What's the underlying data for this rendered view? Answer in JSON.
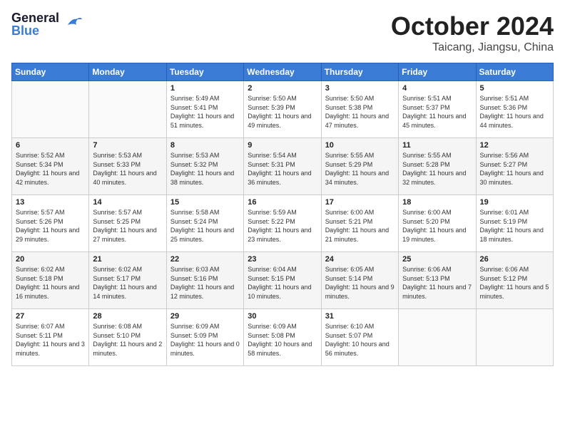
{
  "logo": {
    "general": "General",
    "blue": "Blue"
  },
  "title": "October 2024",
  "subtitle": "Taicang, Jiangsu, China",
  "weekdays": [
    "Sunday",
    "Monday",
    "Tuesday",
    "Wednesday",
    "Thursday",
    "Friday",
    "Saturday"
  ],
  "weeks": [
    [
      {
        "day": "",
        "info": ""
      },
      {
        "day": "",
        "info": ""
      },
      {
        "day": "1",
        "info": "Sunrise: 5:49 AM\nSunset: 5:41 PM\nDaylight: 11 hours and 51 minutes."
      },
      {
        "day": "2",
        "info": "Sunrise: 5:50 AM\nSunset: 5:39 PM\nDaylight: 11 hours and 49 minutes."
      },
      {
        "day": "3",
        "info": "Sunrise: 5:50 AM\nSunset: 5:38 PM\nDaylight: 11 hours and 47 minutes."
      },
      {
        "day": "4",
        "info": "Sunrise: 5:51 AM\nSunset: 5:37 PM\nDaylight: 11 hours and 45 minutes."
      },
      {
        "day": "5",
        "info": "Sunrise: 5:51 AM\nSunset: 5:36 PM\nDaylight: 11 hours and 44 minutes."
      }
    ],
    [
      {
        "day": "6",
        "info": "Sunrise: 5:52 AM\nSunset: 5:34 PM\nDaylight: 11 hours and 42 minutes."
      },
      {
        "day": "7",
        "info": "Sunrise: 5:53 AM\nSunset: 5:33 PM\nDaylight: 11 hours and 40 minutes."
      },
      {
        "day": "8",
        "info": "Sunrise: 5:53 AM\nSunset: 5:32 PM\nDaylight: 11 hours and 38 minutes."
      },
      {
        "day": "9",
        "info": "Sunrise: 5:54 AM\nSunset: 5:31 PM\nDaylight: 11 hours and 36 minutes."
      },
      {
        "day": "10",
        "info": "Sunrise: 5:55 AM\nSunset: 5:29 PM\nDaylight: 11 hours and 34 minutes."
      },
      {
        "day": "11",
        "info": "Sunrise: 5:55 AM\nSunset: 5:28 PM\nDaylight: 11 hours and 32 minutes."
      },
      {
        "day": "12",
        "info": "Sunrise: 5:56 AM\nSunset: 5:27 PM\nDaylight: 11 hours and 30 minutes."
      }
    ],
    [
      {
        "day": "13",
        "info": "Sunrise: 5:57 AM\nSunset: 5:26 PM\nDaylight: 11 hours and 29 minutes."
      },
      {
        "day": "14",
        "info": "Sunrise: 5:57 AM\nSunset: 5:25 PM\nDaylight: 11 hours and 27 minutes."
      },
      {
        "day": "15",
        "info": "Sunrise: 5:58 AM\nSunset: 5:24 PM\nDaylight: 11 hours and 25 minutes."
      },
      {
        "day": "16",
        "info": "Sunrise: 5:59 AM\nSunset: 5:22 PM\nDaylight: 11 hours and 23 minutes."
      },
      {
        "day": "17",
        "info": "Sunrise: 6:00 AM\nSunset: 5:21 PM\nDaylight: 11 hours and 21 minutes."
      },
      {
        "day": "18",
        "info": "Sunrise: 6:00 AM\nSunset: 5:20 PM\nDaylight: 11 hours and 19 minutes."
      },
      {
        "day": "19",
        "info": "Sunrise: 6:01 AM\nSunset: 5:19 PM\nDaylight: 11 hours and 18 minutes."
      }
    ],
    [
      {
        "day": "20",
        "info": "Sunrise: 6:02 AM\nSunset: 5:18 PM\nDaylight: 11 hours and 16 minutes."
      },
      {
        "day": "21",
        "info": "Sunrise: 6:02 AM\nSunset: 5:17 PM\nDaylight: 11 hours and 14 minutes."
      },
      {
        "day": "22",
        "info": "Sunrise: 6:03 AM\nSunset: 5:16 PM\nDaylight: 11 hours and 12 minutes."
      },
      {
        "day": "23",
        "info": "Sunrise: 6:04 AM\nSunset: 5:15 PM\nDaylight: 11 hours and 10 minutes."
      },
      {
        "day": "24",
        "info": "Sunrise: 6:05 AM\nSunset: 5:14 PM\nDaylight: 11 hours and 9 minutes."
      },
      {
        "day": "25",
        "info": "Sunrise: 6:06 AM\nSunset: 5:13 PM\nDaylight: 11 hours and 7 minutes."
      },
      {
        "day": "26",
        "info": "Sunrise: 6:06 AM\nSunset: 5:12 PM\nDaylight: 11 hours and 5 minutes."
      }
    ],
    [
      {
        "day": "27",
        "info": "Sunrise: 6:07 AM\nSunset: 5:11 PM\nDaylight: 11 hours and 3 minutes."
      },
      {
        "day": "28",
        "info": "Sunrise: 6:08 AM\nSunset: 5:10 PM\nDaylight: 11 hours and 2 minutes."
      },
      {
        "day": "29",
        "info": "Sunrise: 6:09 AM\nSunset: 5:09 PM\nDaylight: 11 hours and 0 minutes."
      },
      {
        "day": "30",
        "info": "Sunrise: 6:09 AM\nSunset: 5:08 PM\nDaylight: 10 hours and 58 minutes."
      },
      {
        "day": "31",
        "info": "Sunrise: 6:10 AM\nSunset: 5:07 PM\nDaylight: 10 hours and 56 minutes."
      },
      {
        "day": "",
        "info": ""
      },
      {
        "day": "",
        "info": ""
      }
    ]
  ]
}
